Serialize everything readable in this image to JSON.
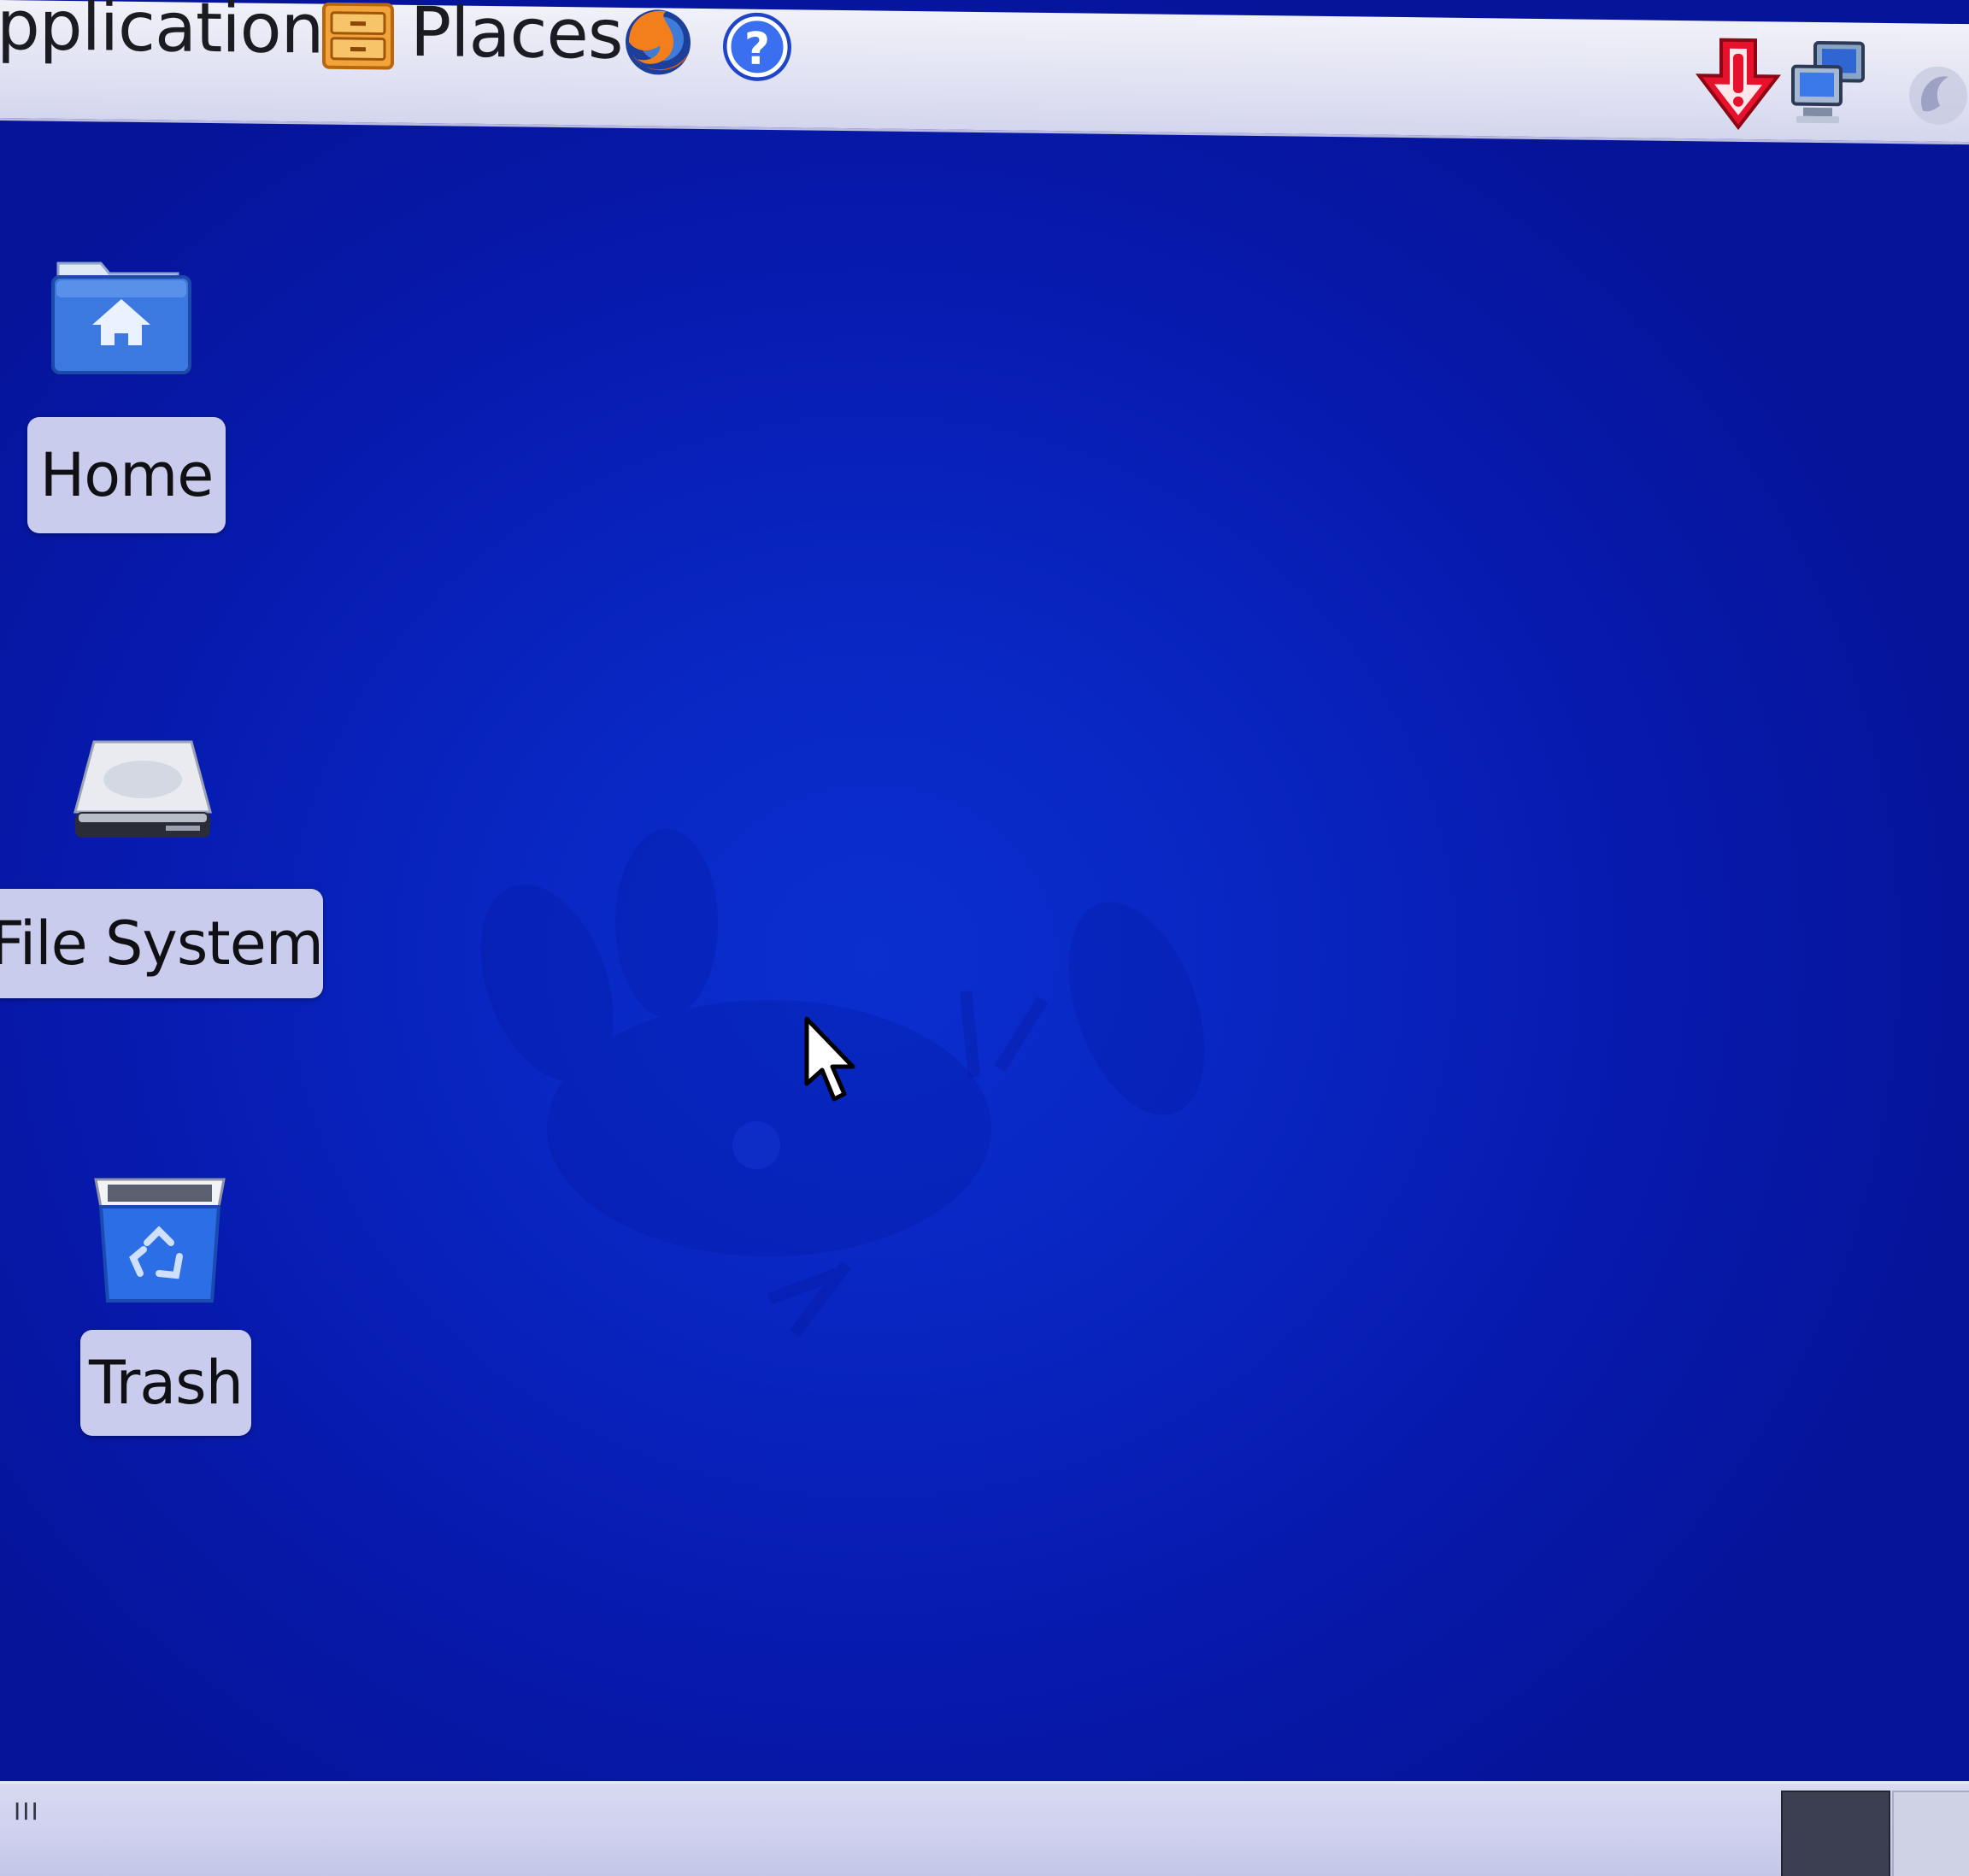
{
  "top_panel": {
    "applications_label": "pplications",
    "places_label": "Places",
    "icons": {
      "places": "drawer-icon",
      "browser": "firefox-icon",
      "help": "help-icon",
      "update": "update-notifier-icon",
      "network": "network-icon",
      "fedora": "fedora-icon"
    }
  },
  "desktop": {
    "icons": [
      {
        "label": "Home",
        "icon": "home-folder-icon"
      },
      {
        "label": "File System",
        "icon": "harddrive-icon"
      },
      {
        "label": "Trash",
        "icon": "trash-icon"
      }
    ]
  },
  "bottom_panel": {
    "show_desktop_handle": "III",
    "workspaces": [
      "workspace-1",
      "workspace-2"
    ]
  },
  "colors": {
    "desktop_blue": "#0926c2",
    "panel": "#dcdef2",
    "update_red": "#e8112d"
  }
}
